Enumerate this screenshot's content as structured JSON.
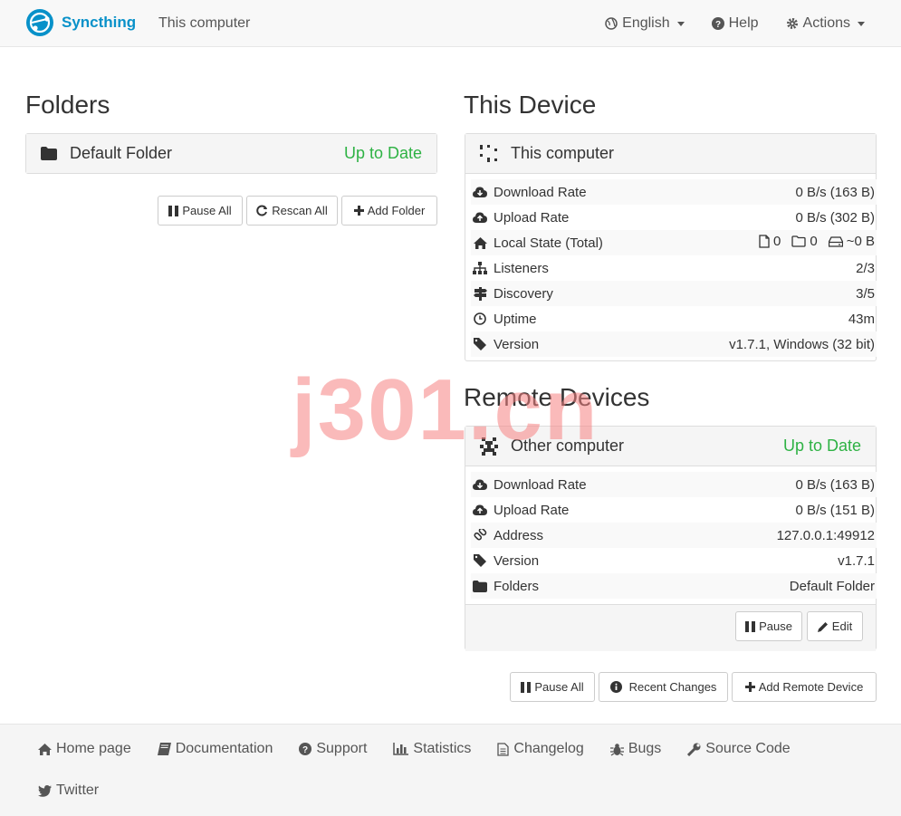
{
  "navbar": {
    "brand": "Syncthing",
    "device_name": "This computer",
    "language": "English",
    "help": "Help",
    "actions": "Actions"
  },
  "folders": {
    "heading": "Folders",
    "items": [
      {
        "name": "Default Folder",
        "status": "Up to Date"
      }
    ],
    "buttons": {
      "pause_all": "Pause All",
      "rescan_all": "Rescan All",
      "add_folder": "Add Folder"
    }
  },
  "this_device": {
    "heading": "This Device",
    "name": "This computer",
    "rows": [
      {
        "icon": "cloud-download-icon",
        "label": "Download Rate",
        "value": "0 B/s (163 B)"
      },
      {
        "icon": "cloud-upload-icon",
        "label": "Upload Rate",
        "value": "0 B/s (302 B)"
      },
      {
        "icon": "home-icon",
        "label": "Local State (Total)",
        "value": ""
      },
      {
        "icon": "sitemap-icon",
        "label": "Listeners",
        "value": "2/3"
      },
      {
        "icon": "signpost-icon",
        "label": "Discovery",
        "value": "3/5"
      },
      {
        "icon": "clock-icon",
        "label": "Uptime",
        "value": "43m"
      },
      {
        "icon": "tag-icon",
        "label": "Version",
        "value": "v1.7.1, Windows (32 bit)"
      }
    ],
    "local_state": {
      "files": "0",
      "dirs": "0",
      "size": "~0 B"
    }
  },
  "remote_devices": {
    "heading": "Remote Devices",
    "items": [
      {
        "name": "Other computer",
        "status": "Up to Date",
        "rows": [
          {
            "icon": "cloud-download-icon",
            "label": "Download Rate",
            "value": "0 B/s (163 B)"
          },
          {
            "icon": "cloud-upload-icon",
            "label": "Upload Rate",
            "value": "0 B/s (151 B)"
          },
          {
            "icon": "link-icon",
            "label": "Address",
            "value": "127.0.0.1:49912"
          },
          {
            "icon": "tag-icon",
            "label": "Version",
            "value": "v1.7.1"
          },
          {
            "icon": "folder-icon",
            "label": "Folders",
            "value": "Default Folder"
          }
        ],
        "buttons": {
          "pause": "Pause",
          "edit": "Edit"
        }
      }
    ],
    "buttons": {
      "pause_all": "Pause All",
      "recent_changes": "Recent Changes",
      "add_remote": "Add Remote Device"
    }
  },
  "footer": {
    "links": [
      {
        "icon": "home-icon",
        "label": "Home page"
      },
      {
        "icon": "book-icon",
        "label": "Documentation"
      },
      {
        "icon": "question-circle-icon",
        "label": "Support"
      },
      {
        "icon": "bar-chart-icon",
        "label": "Statistics"
      },
      {
        "icon": "file-text-icon",
        "label": "Changelog"
      },
      {
        "icon": "bug-icon",
        "label": "Bugs"
      },
      {
        "icon": "wrench-icon",
        "label": "Source Code"
      },
      {
        "icon": "twitter-icon",
        "label": "Twitter"
      }
    ]
  },
  "watermark": "j301.cn",
  "colors": {
    "brand": "#0891c9",
    "status_ok": "#2eb244"
  }
}
